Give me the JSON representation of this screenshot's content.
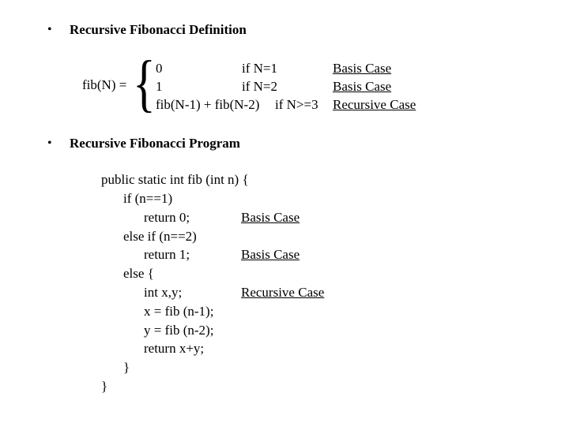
{
  "section1": {
    "bullet": "•",
    "heading": "Recursive Fibonacci Definition",
    "lhs": "fib(N) =",
    "brace": "{",
    "cases": [
      {
        "value": "0",
        "condition": "if N=1",
        "label": "Basis Case"
      },
      {
        "value": "1",
        "condition": "if N=2",
        "label": "Basis Case"
      },
      {
        "value": "fib(N-1) + fib(N-2)",
        "condition": "if N>=3",
        "label": "Recursive Case"
      }
    ]
  },
  "section2": {
    "bullet": "•",
    "heading": "Recursive Fibonacci Program",
    "code_lines": [
      "public static int fib (int n) {",
      "if (n==1)",
      "return 0;",
      "else if (n==2)",
      "return 1;",
      "else {",
      "int x,y;",
      "x = fib (n-1);",
      "y = fib (n-2);",
      "return x+y;",
      "}",
      "}"
    ],
    "annotations": [
      "Basis Case",
      "Basis Case",
      "Recursive Case"
    ]
  }
}
